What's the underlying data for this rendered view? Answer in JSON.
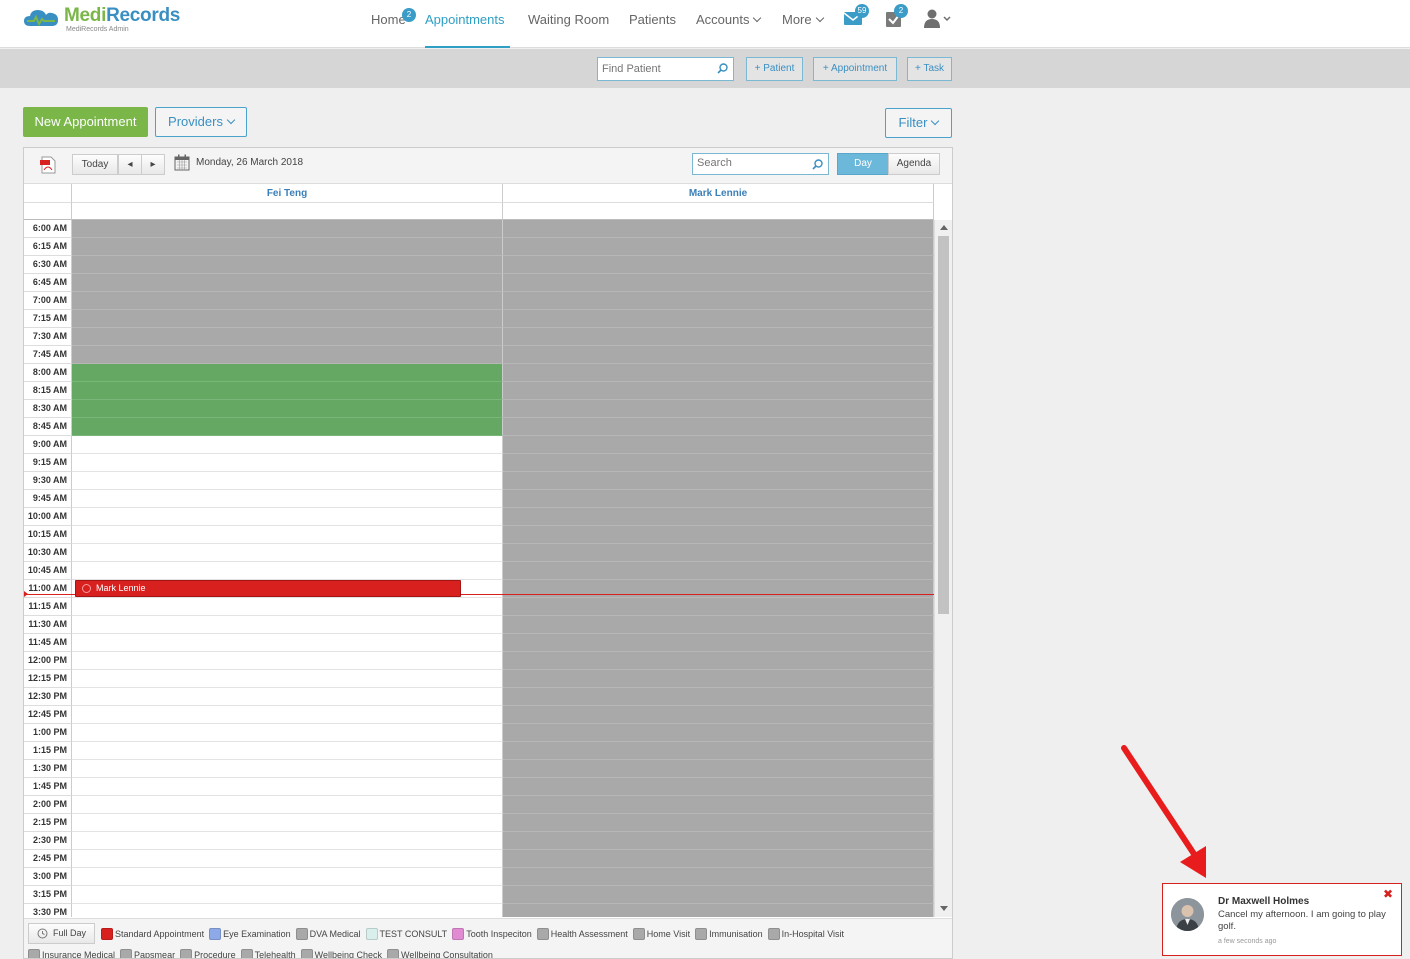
{
  "brand": {
    "name_part1": "Medi",
    "name_part2": "Records",
    "subtitle": "MediRecords Admin"
  },
  "nav": {
    "home": "Home",
    "home_badge": "2",
    "appointments": "Appointments",
    "waiting_room": "Waiting Room",
    "patients": "Patients",
    "accounts": "Accounts",
    "more": "More",
    "messages_badge": "59",
    "tasks_badge": "2"
  },
  "subbar": {
    "find_patient_placeholder": "Find Patient",
    "add_patient": "+ Patient",
    "add_appointment": "+ Appointment",
    "add_task": "+ Task"
  },
  "actions": {
    "new_appointment": "New Appointment",
    "providers": "Providers",
    "filter": "Filter"
  },
  "calendar": {
    "today": "Today",
    "prev": "◂",
    "next": "▸",
    "date": "Monday, 26 March 2018",
    "search_placeholder": "Search",
    "view_day": "Day",
    "view_agenda": "Agenda",
    "providers": [
      "Fei Teng",
      "Mark Lennie"
    ],
    "times": [
      "6:00 AM",
      "6:15 AM",
      "6:30 AM",
      "6:45 AM",
      "7:00 AM",
      "7:15 AM",
      "7:30 AM",
      "7:45 AM",
      "8:00 AM",
      "8:15 AM",
      "8:30 AM",
      "8:45 AM",
      "9:00 AM",
      "9:15 AM",
      "9:30 AM",
      "9:45 AM",
      "10:00 AM",
      "10:15 AM",
      "10:30 AM",
      "10:45 AM",
      "11:00 AM",
      "11:15 AM",
      "11:30 AM",
      "11:45 AM",
      "12:00 PM",
      "12:15 PM",
      "12:30 PM",
      "12:45 PM",
      "1:00 PM",
      "1:15 PM",
      "1:30 PM",
      "1:45 PM",
      "2:00 PM",
      "2:15 PM",
      "2:30 PM",
      "2:45 PM",
      "3:00 PM",
      "3:15 PM",
      "3:30 PM"
    ],
    "appointment": {
      "patient": "Mark Lennie",
      "time": "11:00 AM",
      "type": "Standard Appointment"
    }
  },
  "legend": {
    "full_day": "Full Day",
    "items": [
      {
        "label": "Standard Appointment",
        "color": "#d8201f"
      },
      {
        "label": "Eye Examination",
        "color": "#8ea9e8"
      },
      {
        "label": "DVA Medical",
        "color": "#a9a9a9"
      },
      {
        "label": "TEST CONSULT",
        "color": "#d9efec"
      },
      {
        "label": "Tooth Inspeciton",
        "color": "#e18bd3"
      },
      {
        "label": "Health Assessment",
        "color": "#a9a9a9"
      },
      {
        "label": "Home Visit",
        "color": "#a9a9a9"
      },
      {
        "label": "Immunisation",
        "color": "#a9a9a9"
      },
      {
        "label": "In-Hospital Visit",
        "color": "#a9a9a9"
      },
      {
        "label": "Insurance Medical",
        "color": "#a9a9a9"
      },
      {
        "label": "Papsmear",
        "color": "#a9a9a9"
      },
      {
        "label": "Procedure",
        "color": "#a9a9a9"
      },
      {
        "label": "Telehealth",
        "color": "#a9a9a9"
      },
      {
        "label": "Wellbeing Check",
        "color": "#a9a9a9"
      },
      {
        "label": "Wellbeing Consultation",
        "color": "#a9a9a9"
      }
    ]
  },
  "toast": {
    "sender": "Dr Maxwell Holmes",
    "message": "Cancel my afternoon. I am going to play golf.",
    "time": "a few seconds ago",
    "close": "✖"
  }
}
